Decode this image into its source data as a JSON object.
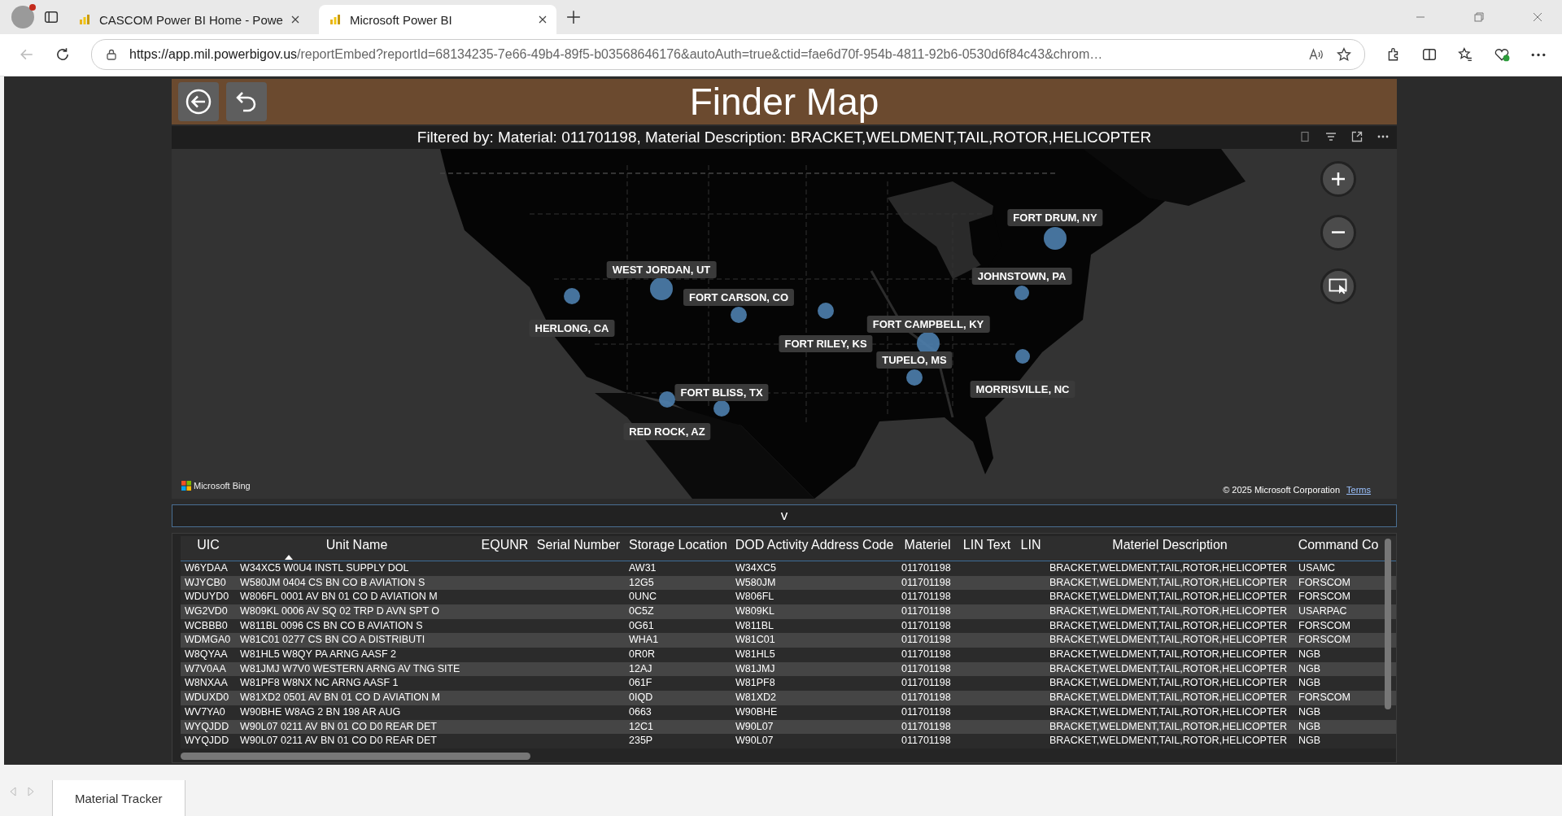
{
  "browser": {
    "tabs": [
      {
        "title": "CASCOM Power BI Home - Powe",
        "selected": false
      },
      {
        "title": "Microsoft Power BI",
        "selected": true
      }
    ],
    "url_host": "https://app.mil.powerbigov.us",
    "url_path": "/reportEmbed?reportId=68134235-7e66-49b4-89f5-b03568646176&autoAuth=true&ctid=fae6d70f-954b-4811-92b6-0530d6f84c43&chrom…"
  },
  "report": {
    "title": "Finder Map",
    "filter_text": "Filtered by: Material: 011701198, Material Description: BRACKET,WELDMENT,TAIL,ROTOR,HELICOPTER",
    "map": {
      "locations": [
        {
          "label": "FORT DRUM, NY"
        },
        {
          "label": "WEST JORDAN, UT"
        },
        {
          "label": "JOHNSTOWN, PA"
        },
        {
          "label": "FORT CARSON, CO"
        },
        {
          "label": "HERLONG, CA"
        },
        {
          "label": "FORT CAMPBELL, KY"
        },
        {
          "label": "FORT RILEY, KS"
        },
        {
          "label": "TUPELO, MS"
        },
        {
          "label": "FORT BLISS, TX"
        },
        {
          "label": "MORRISVILLE, NC"
        },
        {
          "label": "RED ROCK, AZ"
        }
      ],
      "attribution": "Microsoft Bing",
      "copyright": "© 2025 Microsoft Corporation",
      "terms_link": "Terms"
    },
    "toggle_label": "v",
    "table": {
      "columns": [
        {
          "label": "UIC"
        },
        {
          "label": "Unit Name",
          "sorted": true
        },
        {
          "label": "EQUNR"
        },
        {
          "label": "Serial Number"
        },
        {
          "label": "Storage Location"
        },
        {
          "label": "DOD Activity Address Code"
        },
        {
          "label": "Materiel"
        },
        {
          "label": "LIN Text"
        },
        {
          "label": "LIN"
        },
        {
          "label": "Materiel Description"
        },
        {
          "label": "Command Co"
        }
      ],
      "rows": [
        {
          "uic": "W6YDAA",
          "unit_name": "W34XC5 W0U4 INSTL SUPPLY DOL",
          "storage_location": "AW31",
          "dodaac": "W34XC5",
          "materiel": "011701198",
          "description": "BRACKET,WELDMENT,TAIL,ROTOR,HELICOPTER",
          "command": "USAMC"
        },
        {
          "uic": "WJYCB0",
          "unit_name": "W580JM 0404 CS BN CO B AVIATION S",
          "storage_location": "12G5",
          "dodaac": "W580JM",
          "materiel": "011701198",
          "description": "BRACKET,WELDMENT,TAIL,ROTOR,HELICOPTER",
          "command": "FORSCOM"
        },
        {
          "uic": "WDUYD0",
          "unit_name": "W806FL 0001 AV BN 01 CO D AVIATION M",
          "storage_location": "0UNC",
          "dodaac": "W806FL",
          "materiel": "011701198",
          "description": "BRACKET,WELDMENT,TAIL,ROTOR,HELICOPTER",
          "command": "FORSCOM"
        },
        {
          "uic": "WG2VD0",
          "unit_name": "W809KL 0006 AV SQ 02 TRP D AVN SPT O",
          "storage_location": "0C5Z",
          "dodaac": "W809KL",
          "materiel": "011701198",
          "description": "BRACKET,WELDMENT,TAIL,ROTOR,HELICOPTER",
          "command": "USARPAC"
        },
        {
          "uic": "WCBBB0",
          "unit_name": "W811BL 0096 CS BN CO B AVIATION S",
          "storage_location": "0G61",
          "dodaac": "W811BL",
          "materiel": "011701198",
          "description": "BRACKET,WELDMENT,TAIL,ROTOR,HELICOPTER",
          "command": "FORSCOM"
        },
        {
          "uic": "WDMGA0",
          "unit_name": "W81C01 0277 CS BN CO A DISTRIBUTI",
          "storage_location": "WHA1",
          "dodaac": "W81C01",
          "materiel": "011701198",
          "description": "BRACKET,WELDMENT,TAIL,ROTOR,HELICOPTER",
          "command": "FORSCOM"
        },
        {
          "uic": "W8QYAA",
          "unit_name": "W81HL5 W8QY PA ARNG AASF 2",
          "storage_location": "0R0R",
          "dodaac": "W81HL5",
          "materiel": "011701198",
          "description": "BRACKET,WELDMENT,TAIL,ROTOR,HELICOPTER",
          "command": "NGB"
        },
        {
          "uic": "W7V0AA",
          "unit_name": "W81JMJ W7V0 WESTERN ARNG AV TNG SITE",
          "storage_location": "12AJ",
          "dodaac": "W81JMJ",
          "materiel": "011701198",
          "description": "BRACKET,WELDMENT,TAIL,ROTOR,HELICOPTER",
          "command": "NGB"
        },
        {
          "uic": "W8NXAA",
          "unit_name": "W81PF8 W8NX NC ARNG AASF 1",
          "storage_location": "061F",
          "dodaac": "W81PF8",
          "materiel": "011701198",
          "description": "BRACKET,WELDMENT,TAIL,ROTOR,HELICOPTER",
          "command": "NGB"
        },
        {
          "uic": "WDUXD0",
          "unit_name": "W81XD2 0501 AV BN 01 CO D AVIATION M",
          "storage_location": "0IQD",
          "dodaac": "W81XD2",
          "materiel": "011701198",
          "description": "BRACKET,WELDMENT,TAIL,ROTOR,HELICOPTER",
          "command": "FORSCOM"
        },
        {
          "uic": "WV7YA0",
          "unit_name": "W90BHE W8AG 2 BN 198 AR AUG",
          "storage_location": "0663",
          "dodaac": "W90BHE",
          "materiel": "011701198",
          "description": "BRACKET,WELDMENT,TAIL,ROTOR,HELICOPTER",
          "command": "NGB"
        },
        {
          "uic": "WYQJDD",
          "unit_name": "W90L07 0211 AV BN 01 CO D0 REAR DET",
          "storage_location": "12C1",
          "dodaac": "W90L07",
          "materiel": "011701198",
          "description": "BRACKET,WELDMENT,TAIL,ROTOR,HELICOPTER",
          "command": "NGB"
        },
        {
          "uic": "WYQJDD",
          "unit_name": "W90L07 0211 AV BN 01 CO D0 REAR DET",
          "storage_location": "235P",
          "dodaac": "W90L07",
          "materiel": "011701198",
          "description": "BRACKET,WELDMENT,TAIL,ROTOR,HELICOPTER",
          "command": "NGB"
        }
      ]
    }
  },
  "page_tabs": [
    {
      "label": "Material Tracker",
      "selected": true
    }
  ]
}
